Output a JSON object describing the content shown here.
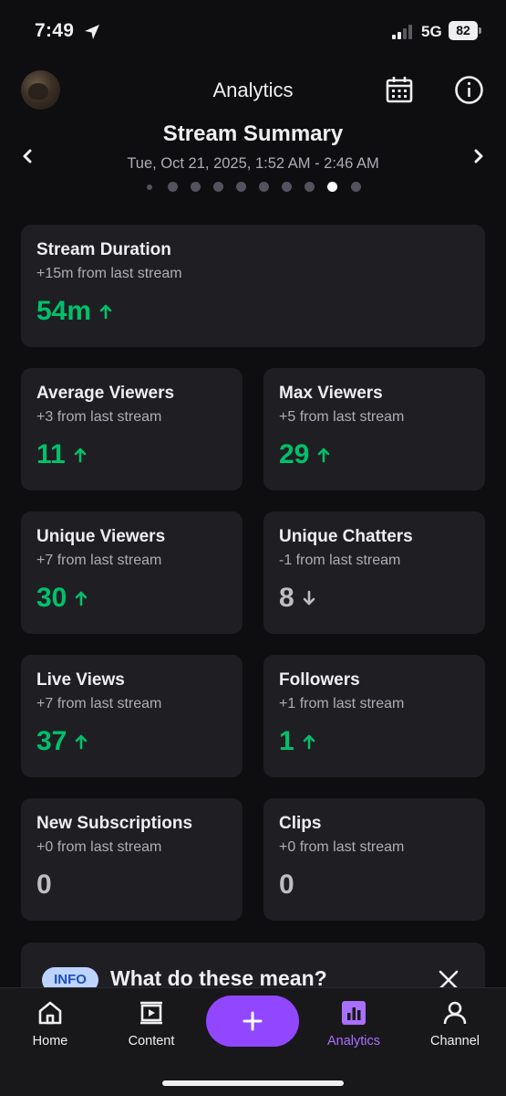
{
  "status_bar": {
    "time": "7:49",
    "network": "5G",
    "battery": "82"
  },
  "header": {
    "title": "Analytics"
  },
  "summary": {
    "title": "Stream Summary",
    "date_range": "Tue, Oct 21, 2025, 1:52 AM - 2:46 AM",
    "page_count": 10,
    "active_page": 9
  },
  "colors": {
    "up": "#00c16a",
    "accent": "#9147ff",
    "card_bg": "#1f1f23",
    "background": "#0e0e10"
  },
  "stats": {
    "stream_duration": {
      "label": "Stream Duration",
      "sub": "+15m from last stream",
      "value": "54m",
      "trend": "up"
    },
    "average_viewers": {
      "label": "Average Viewers",
      "sub": "+3 from last stream",
      "value": "11",
      "trend": "up"
    },
    "max_viewers": {
      "label": "Max Viewers",
      "sub": "+5 from last stream",
      "value": "29",
      "trend": "up"
    },
    "unique_viewers": {
      "label": "Unique Viewers",
      "sub": "+7 from last stream",
      "value": "30",
      "trend": "up"
    },
    "unique_chatters": {
      "label": "Unique Chatters",
      "sub": "-1 from last stream",
      "value": "8",
      "trend": "down"
    },
    "live_views": {
      "label": "Live Views",
      "sub": "+7 from last stream",
      "value": "37",
      "trend": "up"
    },
    "followers": {
      "label": "Followers",
      "sub": "+1 from last stream",
      "value": "1",
      "trend": "up"
    },
    "new_subscriptions": {
      "label": "New Subscriptions",
      "sub": "+0 from last stream",
      "value": "0",
      "trend": "none"
    },
    "clips": {
      "label": "Clips",
      "sub": "+0 from last stream",
      "value": "0",
      "trend": "none"
    }
  },
  "info_card": {
    "badge": "INFO",
    "title": "What do these mean?"
  },
  "nav": {
    "home": "Home",
    "content": "Content",
    "analytics": "Analytics",
    "channel": "Channel",
    "active": "analytics"
  }
}
